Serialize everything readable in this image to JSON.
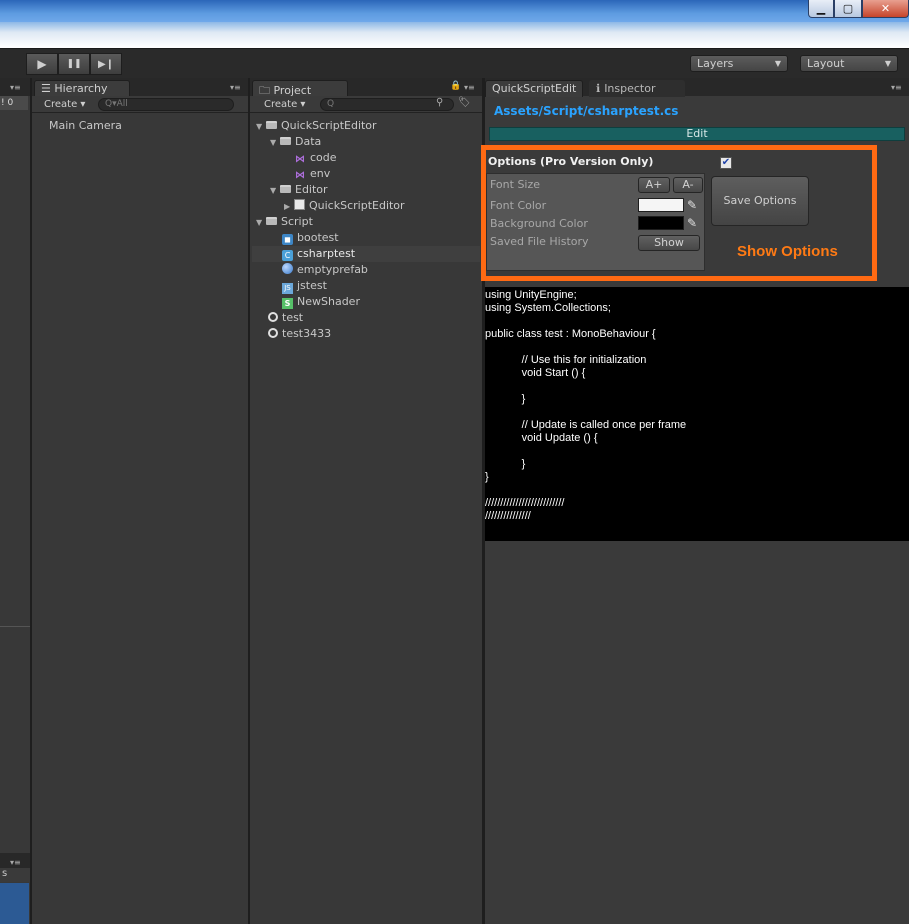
{
  "window": {
    "min_glyph": "▁",
    "max_glyph": "▢",
    "close_glyph": "✕"
  },
  "toolbar": {
    "play_glyph": "▶",
    "pause_glyph": "❚❚",
    "step_glyph": "▶❙",
    "layers_label": "Layers",
    "layout_label": "Layout",
    "dropdown_arrow": "▼"
  },
  "scene_panel": {
    "badge": "! 0",
    "bottom_label": "s"
  },
  "hierarchy": {
    "tab_label": "☰ Hierarchy",
    "create_label": "Create ▾",
    "search_placeholder": "Q▾All",
    "items": [
      "Main Camera"
    ]
  },
  "project": {
    "tab_label": "🗀 Project",
    "create_label": "Create ▾",
    "search_placeholder": "Q",
    "tree": [
      {
        "label": "QuickScriptEditor",
        "icon": "folder-icon",
        "arrow": "▼"
      },
      {
        "label": "Data",
        "icon": "folder-icon",
        "arrow": "▼"
      },
      {
        "label": "code",
        "icon": "visual-studio-icon"
      },
      {
        "label": "env",
        "icon": "visual-studio-icon"
      },
      {
        "label": "Editor",
        "icon": "folder-icon",
        "arrow": "▼"
      },
      {
        "label": "QuickScriptEditor",
        "icon": "file-icon",
        "arrow": "▶"
      },
      {
        "label": "Script",
        "icon": "folder-icon",
        "arrow": "▼"
      },
      {
        "label": "bootest",
        "icon": "boo-script-icon"
      },
      {
        "label": "csharptest",
        "icon": "csharp-script-icon"
      },
      {
        "label": "emptyprefab",
        "icon": "prefab-sphere-icon"
      },
      {
        "label": "jstest",
        "icon": "javascript-icon"
      },
      {
        "label": "NewShader",
        "icon": "shader-icon"
      },
      {
        "label": "test",
        "icon": "unity-scene-icon"
      },
      {
        "label": "test3433",
        "icon": "unity-scene-icon"
      }
    ]
  },
  "quickscript": {
    "tab_label": "QuickScriptEdit",
    "inspector_tab": "Inspector",
    "inspector_icon_glyph": "ℹ",
    "file_path": "Assets/Script/csharptest.cs",
    "edit_label": "Edit",
    "options_title": "Options (Pro Version Only)",
    "checkbox_glyph": "✔",
    "font_size_label": "Font Size",
    "font_increase": "A+",
    "font_decrease": "A-",
    "font_color_label": "Font Color",
    "font_color": "#f5f5f5",
    "background_color_label": "Background Color",
    "background_color": "#000000",
    "saved_history_label": "Saved File History",
    "show_label": "Show",
    "save_options_label": "Save Options",
    "annotation": "Show Options",
    "pencil_glyph": "✎",
    "accent_color": "#ff6a13",
    "link_color": "#2aa3ff",
    "code_lines": [
      "using UnityEngine;",
      "using System.Collections;",
      "",
      "public class test : MonoBehaviour {",
      "",
      "            // Use this for initialization",
      "            void Start () {",
      "",
      "            }",
      "",
      "            // Update is called once per frame",
      "            void Update () {",
      "",
      "            }",
      "}",
      "",
      "//////////////////////////",
      "///////////////"
    ]
  },
  "menu_glyph": "▾≡"
}
